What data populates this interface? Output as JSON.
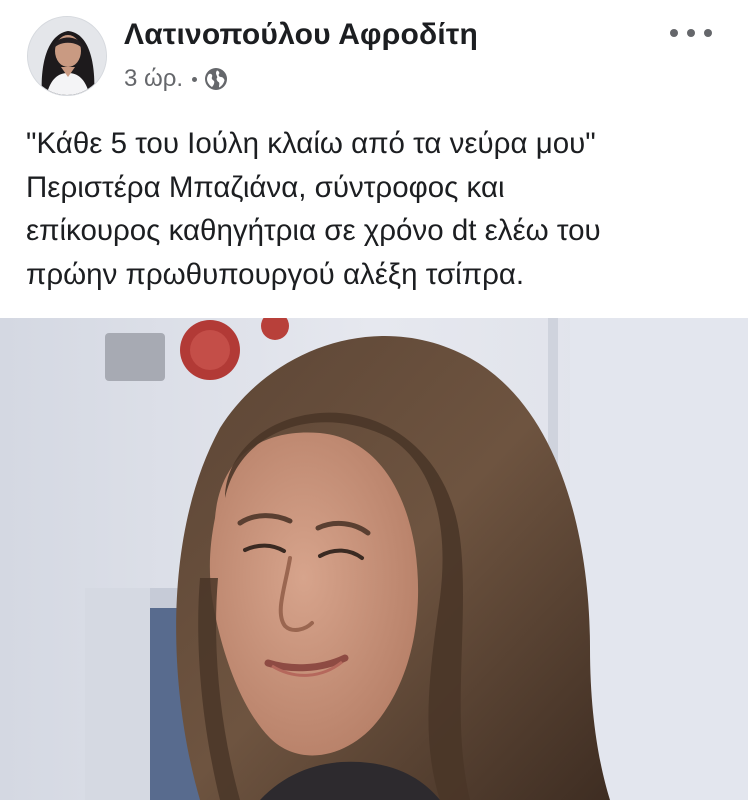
{
  "post": {
    "author": {
      "name": "Λατινοπούλου Αφροδίτη",
      "avatar": "profile-photo"
    },
    "meta": {
      "time": "3 ώρ.",
      "separator": "•",
      "privacy_icon": "globe-icon"
    },
    "more_icon": "ellipsis-icon",
    "text_lines": [
      "\"Κάθε 5 του Ιούλη κλαίω από τα νεύρα μου\"",
      "Περιστέρα Μπαζιάνα,  σύντροφος και",
      "επίκουρος καθηγήτρια σε χρόνο dt ελέω του",
      "πρώην πρωθυπουργού αλέξη τσίπρα."
    ],
    "photo": "photo of a woman with long brown hair crying"
  },
  "colors": {
    "text": "#1c1e21",
    "secondary_text": "#65676b",
    "background": "#ffffff"
  }
}
